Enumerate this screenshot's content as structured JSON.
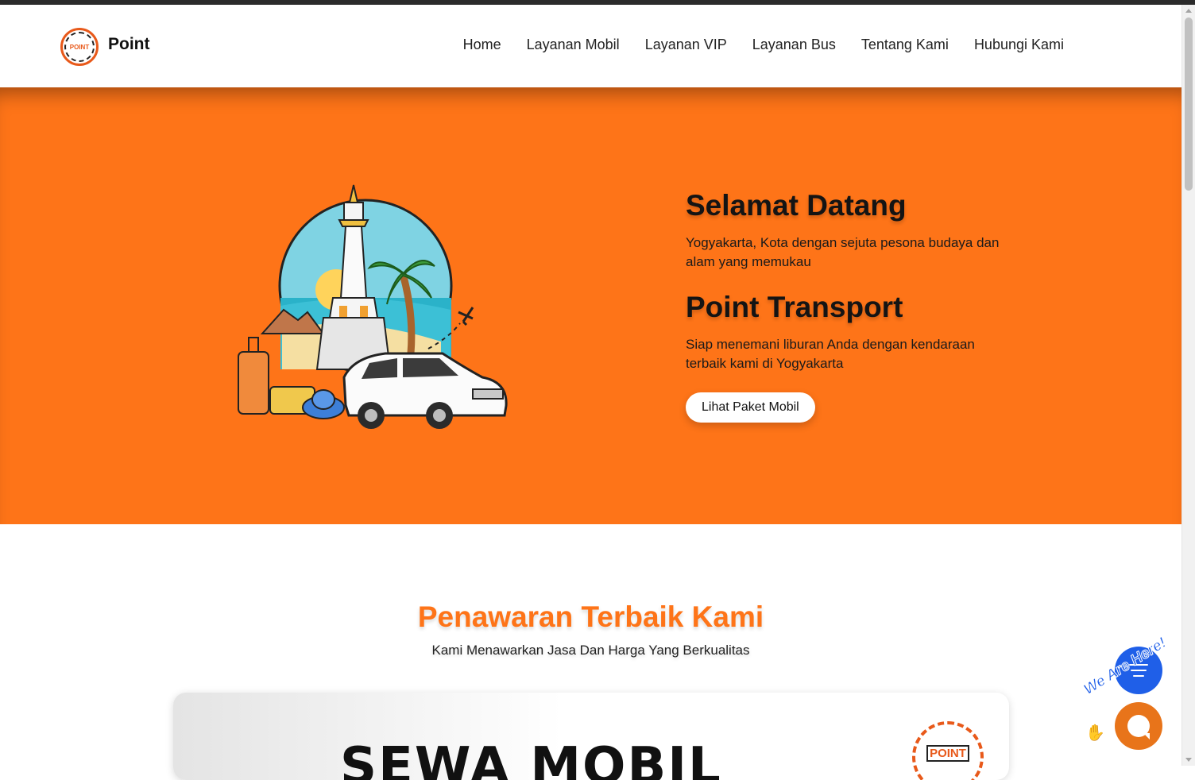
{
  "brand": {
    "name": "Point",
    "logo_text": "POINT"
  },
  "nav": [
    {
      "label": "Home"
    },
    {
      "label": "Layanan Mobil"
    },
    {
      "label": "Layanan VIP"
    },
    {
      "label": "Layanan Bus"
    },
    {
      "label": "Tentang Kami"
    },
    {
      "label": "Hubungi Kami"
    }
  ],
  "hero": {
    "title1": "Selamat Datang",
    "desc1": "Yogyakarta, Kota dengan sejuta pesona budaya dan alam yang memukau",
    "title2": "Point Transport",
    "desc2": "Siap menemani liburan Anda dengan kendaraan terbaik kami di Yogyakarta",
    "button": "Lihat Paket Mobil"
  },
  "offer": {
    "title": "Penawaran Terbaik Kami",
    "subtitle": "Kami Menawarkan Jasa Dan Harga Yang Berkualitas"
  },
  "card": {
    "headline": "SEWA MOBIL",
    "logo_text": "POINT"
  },
  "widget": {
    "tagline": "We Are Here!"
  },
  "colors": {
    "accent": "#fe7418",
    "widget_blue": "#1f5fe8",
    "widget_orange": "#e8741a"
  }
}
